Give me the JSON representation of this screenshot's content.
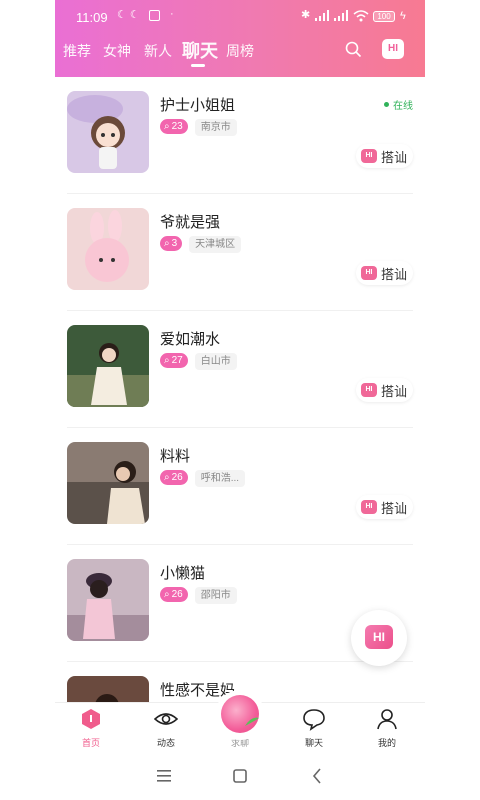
{
  "status": {
    "time": "11:09",
    "battery": "100"
  },
  "tabs": [
    {
      "label": "推荐"
    },
    {
      "label": "女神"
    },
    {
      "label": "新人"
    },
    {
      "label": "聊天"
    },
    {
      "label": "周榜"
    }
  ],
  "header": {
    "hi_label": "HI"
  },
  "users": [
    {
      "name": "护士小姐姐",
      "count": "23",
      "city": "南京市",
      "online": "在线",
      "action": "搭讪"
    },
    {
      "name": "爷就是强",
      "count": "3",
      "city": "天津城区",
      "online": "",
      "action": "搭讪"
    },
    {
      "name": "爱如潮水",
      "count": "27",
      "city": "白山市",
      "online": "",
      "action": "搭讪"
    },
    {
      "name": "料料",
      "count": "26",
      "city": "呼和浩...",
      "online": "",
      "action": "搭讪"
    },
    {
      "name": "小懒猫",
      "count": "26",
      "city": "邵阳市",
      "online": "",
      "action": ""
    },
    {
      "name": "性感不是妈",
      "count": "",
      "city": "",
      "online": "",
      "action": ""
    }
  ],
  "fab": {
    "label": "HI"
  },
  "nav": [
    {
      "label": "首页"
    },
    {
      "label": "动态"
    },
    {
      "label": "求聊"
    },
    {
      "label": "聊天"
    },
    {
      "label": "我的"
    }
  ],
  "colors": {
    "accent": "#f05c8c",
    "online": "#31b25a",
    "header_start": "#ea6fd4",
    "header_end": "#f77a92"
  }
}
